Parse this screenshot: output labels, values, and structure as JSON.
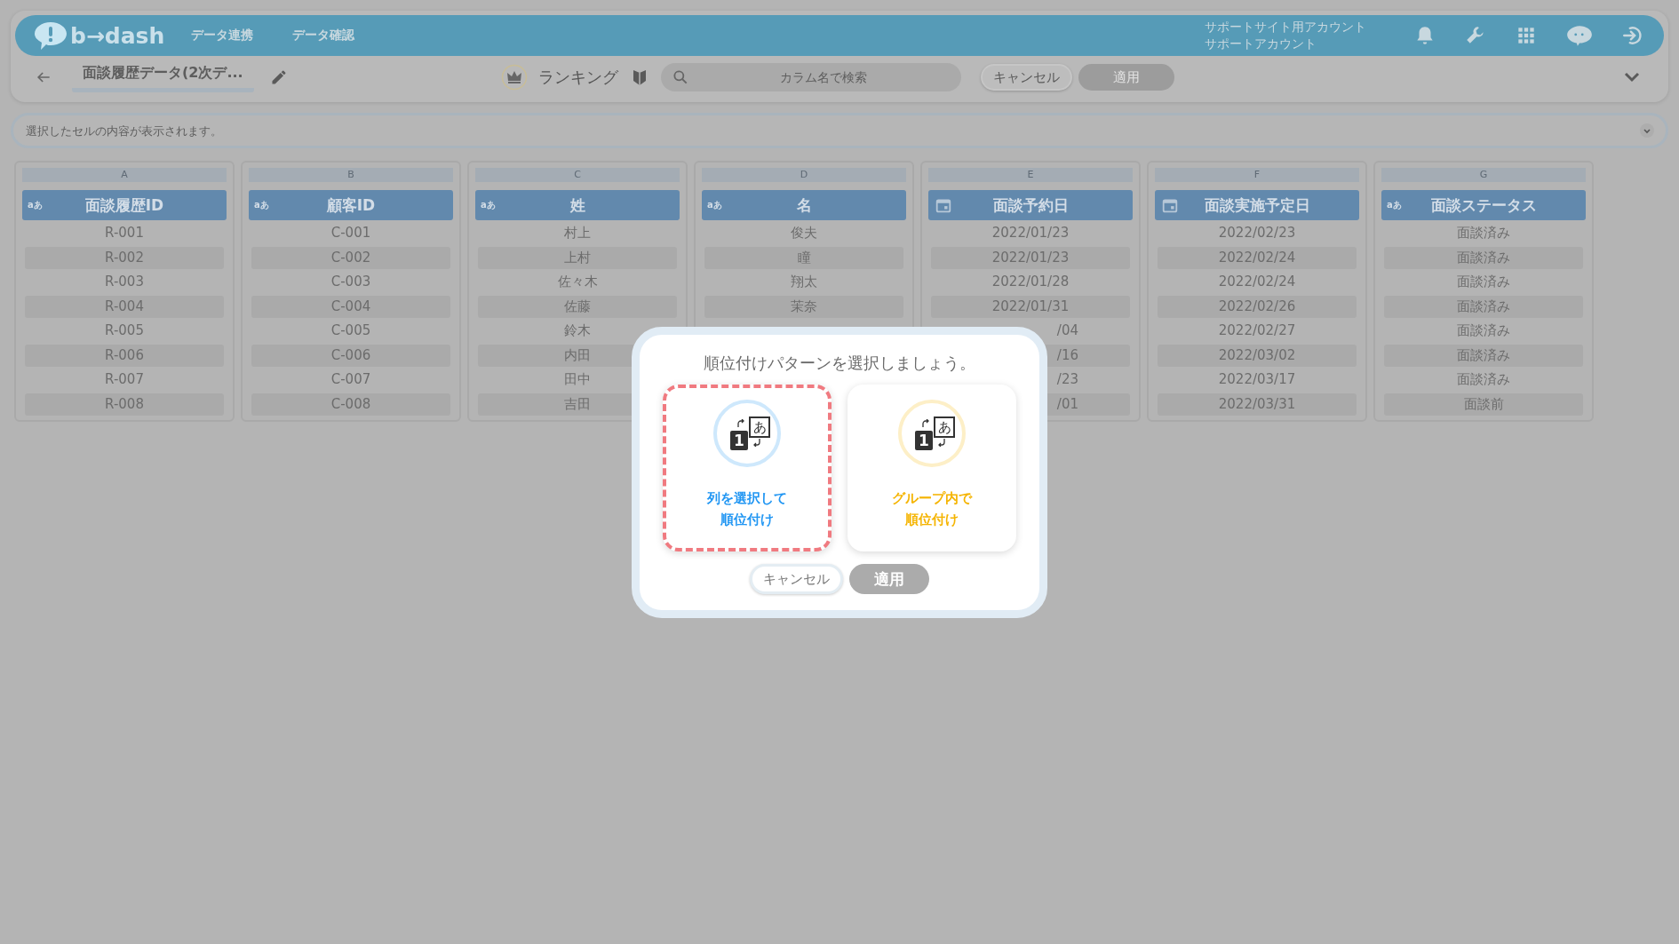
{
  "header": {
    "logo": "b→dash",
    "nav": [
      "データ連携",
      "データ確認"
    ],
    "account": [
      "サポートサイト用アカウント",
      "サポートアカウント"
    ]
  },
  "toolbar": {
    "title": "面談履歴データ(2次デ...",
    "mode": "ランキング",
    "search": {
      "placeholder": "カラム名で検索"
    },
    "buttons": [
      {
        "label": "キャンセル",
        "kind": "outline"
      },
      {
        "label": "適用",
        "kind": "disabled"
      }
    ]
  },
  "cell_viewer": {
    "placeholder": "選択したセルの内容が表示されます。"
  },
  "table": {
    "columns": [
      {
        "letter": "A",
        "kind": "text",
        "badge": "aあ",
        "name": "面談履歴ID",
        "cells": [
          "R-001",
          "R-002",
          "R-003",
          "R-004",
          "R-005",
          "R-006",
          "R-007",
          "R-008"
        ]
      },
      {
        "letter": "B",
        "kind": "text",
        "badge": "aあ",
        "name": "顧客ID",
        "cells": [
          "C-001",
          "C-002",
          "C-003",
          "C-004",
          "C-005",
          "C-006",
          "C-007",
          "C-008"
        ]
      },
      {
        "letter": "C",
        "kind": "text",
        "badge": "aあ",
        "name": "姓",
        "cells": [
          "村上",
          "上村",
          "佐々木",
          "佐藤",
          "鈴木",
          "内田",
          "田中",
          "吉田"
        ]
      },
      {
        "letter": "D",
        "kind": "text",
        "badge": "aあ",
        "name": "名",
        "cells": [
          "俊夫",
          "瞳",
          "翔太",
          "茉奈"
        ]
      },
      {
        "letter": "E",
        "kind": "date",
        "name": "面談予約日",
        "cells": [
          "2022/01/23",
          "2022/01/23",
          "2022/01/28",
          "2022/01/31"
        ],
        "partial_cells": [
          "/04",
          "/16",
          "/23",
          "/01"
        ]
      },
      {
        "letter": "F",
        "kind": "date",
        "name": "面談実施予定日",
        "cells": [
          "2022/02/23",
          "2022/02/24",
          "2022/02/24",
          "2022/02/26",
          "2022/02/27",
          "2022/03/02",
          "2022/03/17",
          "2022/03/31"
        ]
      },
      {
        "letter": "G",
        "kind": "text",
        "badge": "aあ",
        "name": "面談ステータス",
        "cells": [
          "面談済み",
          "面談済み",
          "面談済み",
          "面談済み",
          "面談済み",
          "面談済み",
          "面談済み",
          "面談前"
        ]
      }
    ]
  },
  "dialog": {
    "title": "順位付けパターンを選択しましょう。",
    "options": [
      {
        "label_lines": [
          "列を選択して",
          "順位付け"
        ],
        "icon_number": "1",
        "icon_kana": "あ",
        "color": "#2196f3",
        "selected": true
      },
      {
        "label_lines": [
          "グループ内で",
          "順位付け"
        ],
        "icon_number": "1",
        "icon_kana": "あ",
        "color": "#f5b400",
        "selected": false
      }
    ],
    "buttons": [
      {
        "label": "キャンセル",
        "kind": "outline"
      },
      {
        "label": "適用",
        "kind": "disabled"
      }
    ]
  }
}
